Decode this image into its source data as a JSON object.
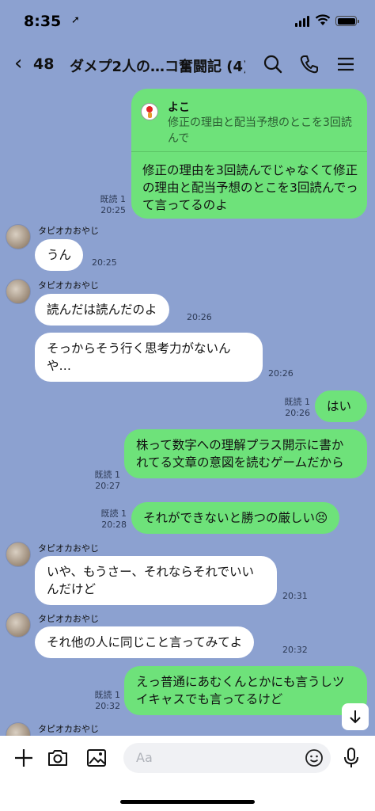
{
  "status": {
    "time": "8:35"
  },
  "header": {
    "back_count": "48",
    "title": "ダメプ2人の…コ奮闘記 (4)"
  },
  "reply": {
    "quoted_name": "よこ",
    "quoted_text": "修正の理由と配当予想のとこを3回読んで",
    "text": "修正の理由を3回読んでじゃなくて修正の理由と配当予想のとこを3回読んでって言ってるのよ",
    "read": "既読 1",
    "time": "20:25"
  },
  "messages": [
    {
      "side": "them",
      "sender": "タピオカおやじ",
      "text": "うん",
      "time": "20:25"
    },
    {
      "side": "them",
      "sender": "タピオカおやじ",
      "text": "読んだは読んだのよ",
      "time": "20:26"
    },
    {
      "side": "them",
      "text": "そっからそう行く思考力がないんや…",
      "time": "20:26"
    },
    {
      "side": "me",
      "text": "はい",
      "read": "既読 1",
      "time": "20:26"
    },
    {
      "side": "me",
      "text": "株って数字への理解プラス開示に書かれてる文章の意図を読むゲームだから",
      "read": "既読 1",
      "time": "20:27"
    },
    {
      "side": "me",
      "text": "それができないと勝つの厳しい😣",
      "read": "既読 1",
      "time": "20:28"
    },
    {
      "side": "them",
      "sender": "タピオカおやじ",
      "text": "いや、もうさー、それならそれでいいんだけど",
      "time": "20:31"
    },
    {
      "side": "them",
      "sender": "タピオカおやじ",
      "text": "それ他の人に同じこと言ってみてよ",
      "time": "20:32"
    },
    {
      "side": "me",
      "text": "えっ普通にあむくんとかにも言うしツイキャスでも言ってるけど",
      "read": "既読 1",
      "time": "20:32"
    }
  ],
  "next_sender": "タピオカおやじ",
  "input": {
    "placeholder": "Aa"
  },
  "icons": {
    "back": "chevron-left-icon",
    "search": "search-icon",
    "call": "phone-icon",
    "menu": "menu-icon",
    "add": "plus-icon",
    "camera": "camera-icon",
    "image": "image-icon",
    "emoji": "emoji-icon",
    "mic": "microphone-icon",
    "scroll": "arrow-down-icon"
  },
  "colors": {
    "background": "#8ca1d0",
    "my_bubble": "#6ee27a",
    "their_bubble": "#ffffff"
  }
}
